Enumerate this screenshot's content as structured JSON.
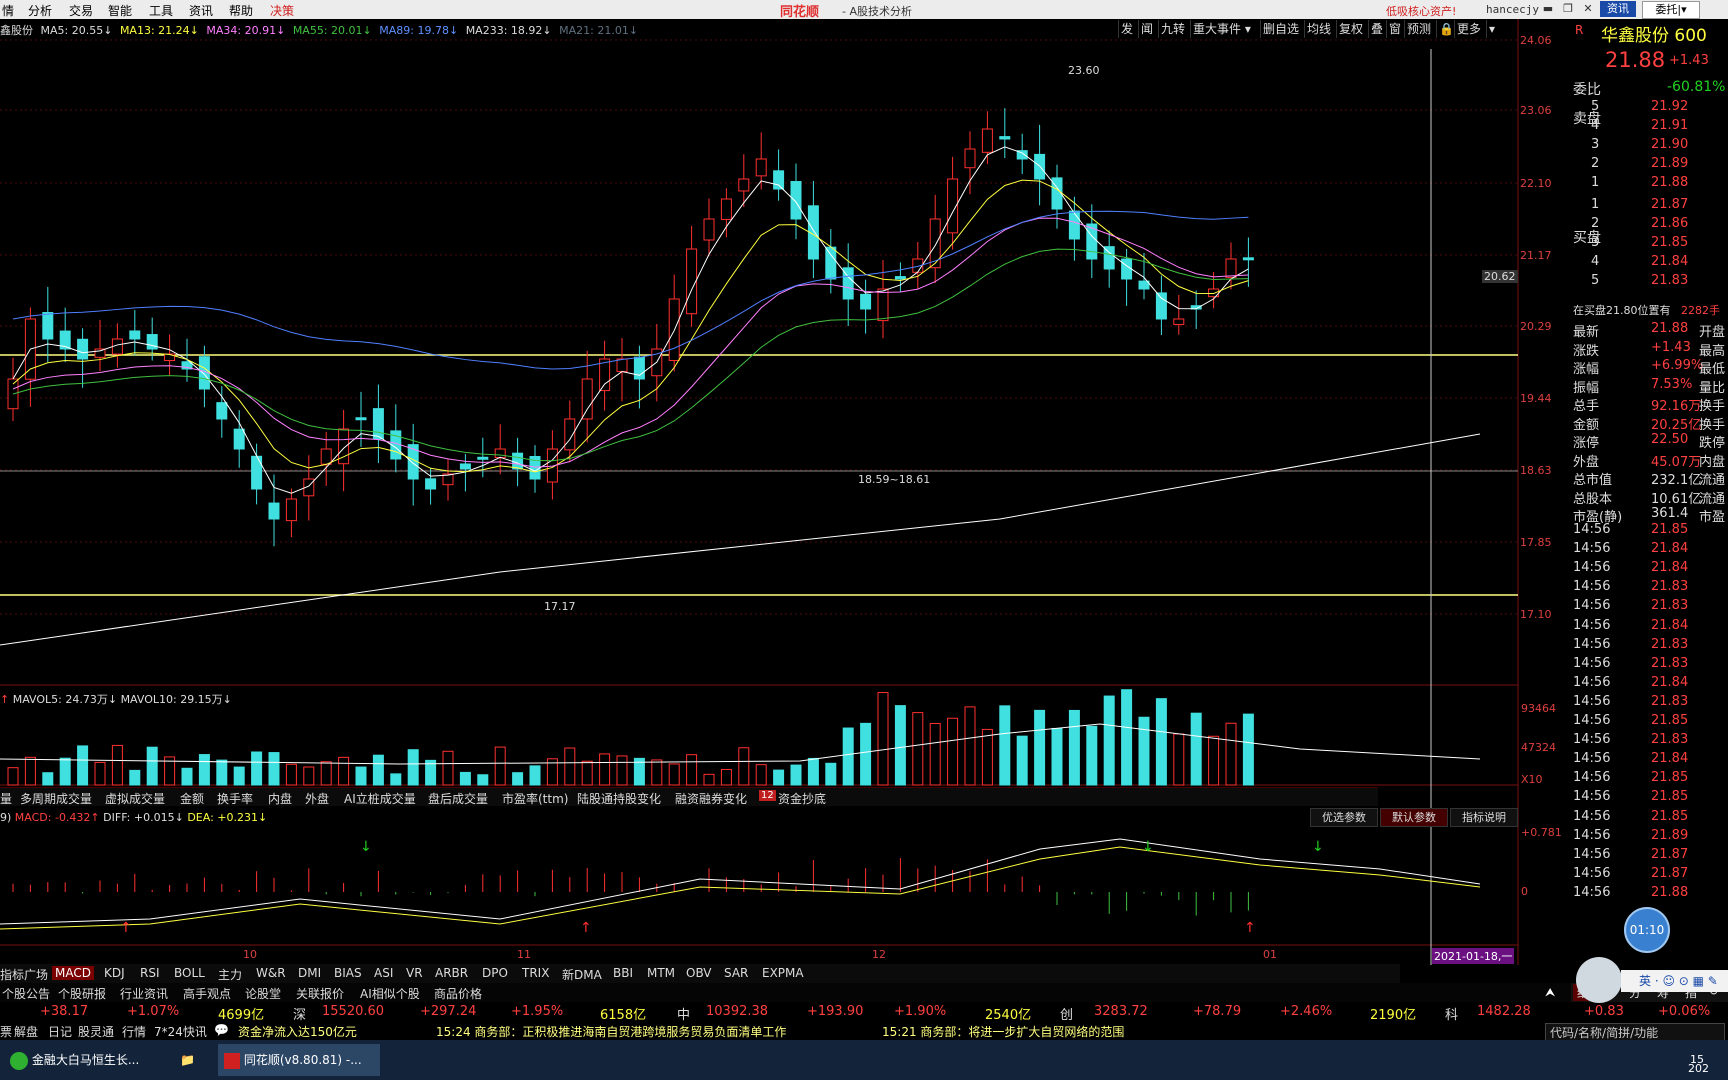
{
  "menubar": {
    "items": [
      "情",
      "分析",
      "交易",
      "智能",
      "工具",
      "资讯",
      "帮助",
      "决策"
    ],
    "brand": "同花顺",
    "subtitle": "- A股技术分析",
    "promo": "低吸核心资产!",
    "user": "hancecjy",
    "tab_news": "资讯",
    "tab_entrust": "委托|▾"
  },
  "ma_legend": {
    "name": "鑫股份",
    "ma5": "MA5: 20.55↓",
    "ma13": "MA13: 21.24↓",
    "ma34": "MA34: 20.91↓",
    "ma55": "MA55: 20.01↓",
    "ma89": "MA89: 19.78↓",
    "ma233": "MA233: 18.92↓",
    "ma21": "MA21: 21.01↓"
  },
  "toolbar": [
    "发",
    "闻",
    "九转",
    "重大事件 ▾",
    "删自选",
    "均线",
    "复权",
    "叠",
    "窗",
    "预测",
    "🔒",
    "更多",
    "▾"
  ],
  "price_axis": [
    "24.06",
    "23.06",
    "22.10",
    "21.17",
    "20.29",
    "19.44",
    "18.63",
    "17.85",
    "17.10"
  ],
  "annotations": {
    "high": "23.60",
    "low": "17.17",
    "range": "18.59~18.61",
    "cur_tag": "20.62"
  },
  "vol_legend": {
    "mavol5": "MAVOL5: 24.73万↓",
    "mavol10": "MAVOL10: 29.15万↓",
    "prefix": "↑"
  },
  "vol_axis": [
    "93464",
    "47324",
    "X10"
  ],
  "vol_tabs": [
    "量",
    "多周期成交量",
    "虚拟成交量",
    "金额",
    "换手率",
    "内盘",
    "外盘",
    "AI立桩成交量",
    "盘后成交量",
    "市盈率(ttm)",
    "陆股通持股变化",
    "融资融券变化",
    "12",
    "资金抄底"
  ],
  "macd_legend": {
    "prefix": "9)",
    "macd": "MACD: -0.432↑",
    "diff": "DIFF: +0.015↓",
    "dea": "DEA: +0.231↓"
  },
  "macd_buttons": [
    "优选参数",
    "默认参数",
    "指标说明"
  ],
  "macd_axis": [
    "+0.781",
    "0"
  ],
  "date_axis": [
    "10",
    "11",
    "12",
    "01"
  ],
  "date_tag": "2021-01-18,一",
  "indicator_tabs": [
    "指标广场",
    "MACD",
    "KDJ",
    "RSI",
    "BOLL",
    "主力",
    "W&R",
    "DMI",
    "BIAS",
    "ASI",
    "VR",
    "ARBR",
    "DPO",
    "TRIX",
    "新DMA",
    "BBI",
    "MTM",
    "OBV",
    "SAR",
    "EXPMA"
  ],
  "info_tabs": [
    "个股公告",
    "个股研报",
    "行业资讯",
    "高手观点",
    "论股堂",
    "关联报价",
    "AI相似个股",
    "商品价格"
  ],
  "index_bar": {
    "sh_chg": "+38.17",
    "sh_pct": "+1.07%",
    "sh_amt": "4699亿",
    "sz_label": "深",
    "sz_val": "15520.60",
    "sz_chg": "+297.24",
    "sz_pct": "+1.95%",
    "sz_amt": "6158亿",
    "zx_label": "中",
    "zx_val": "10392.38",
    "zx_chg": "+193.90",
    "zx_pct": "+1.90%",
    "zx_amt": "2540亿",
    "cy_label": "创",
    "cy_val": "3283.72",
    "cy_chg": "+78.79",
    "cy_pct": "+2.46%",
    "cy_amt": "2190亿",
    "kc_label": "科",
    "kc_val": "1482.28",
    "kc_chg": "+0.83",
    "kc_pct": "+0.06%"
  },
  "ticker": {
    "left": [
      "票",
      "解盘",
      "日记",
      "股灵通",
      "行情",
      "7*24快讯"
    ],
    "news1": "资金净流入达150亿元",
    "news2": "15:24 商务部：正积极推进海南自贸港跨境服务贸易负面清单工作",
    "news3": "15:21 商务部：将进一步扩大自贸网络的范围",
    "search": "代码/名称/简拼/功能"
  },
  "taskbar": {
    "task1": "金融大白马恒生长...",
    "task2": "同花顺(v8.80.81) -...",
    "time": "15",
    "date": "202"
  },
  "right_panel": {
    "title": "华鑫股份 600",
    "tag": "R",
    "price": "21.88",
    "change": "+1.43",
    "weibi_label": "委比",
    "weibi": "-60.81%",
    "sell_label": "卖盘",
    "buy_label": "买盘",
    "sells": [
      {
        "lvl": "5",
        "price": "21.92"
      },
      {
        "lvl": "4",
        "price": "21.91"
      },
      {
        "lvl": "3",
        "price": "21.90"
      },
      {
        "lvl": "2",
        "price": "21.89"
      },
      {
        "lvl": "1",
        "price": "21.88"
      }
    ],
    "buys": [
      {
        "lvl": "1",
        "price": "21.87"
      },
      {
        "lvl": "2",
        "price": "21.86"
      },
      {
        "lvl": "3",
        "price": "21.85"
      },
      {
        "lvl": "4",
        "price": "21.84"
      },
      {
        "lvl": "5",
        "price": "21.83"
      }
    ],
    "zaimai": "在买盘21.80位置有",
    "zaimai_qty": "2282手",
    "stats": [
      {
        "k": "最新",
        "v": "21.88",
        "k2": "开盘"
      },
      {
        "k": "涨跌",
        "v": "+1.43",
        "k2": "最高"
      },
      {
        "k": "涨幅",
        "v": "+6.99%",
        "k2": "最低"
      },
      {
        "k": "振幅",
        "v": "7.53%",
        "k2": "量比"
      },
      {
        "k": "总手",
        "v": "92.16万",
        "k2": "换手"
      },
      {
        "k": "金额",
        "v": "20.25亿",
        "k2": "换手"
      },
      {
        "k": "涨停",
        "v": "22.50",
        "k2": "跌停"
      },
      {
        "k": "外盘",
        "v": "45.07万",
        "k2": "内盘"
      },
      {
        "k": "总市值",
        "v": "232.1亿",
        "k2": "流通"
      },
      {
        "k": "总股本",
        "v": "10.61亿",
        "k2": "流通"
      },
      {
        "k": "市盈(静)",
        "v": "361.4",
        "k2": "市盈"
      }
    ],
    "ticks": [
      {
        "t": "14:56",
        "p": "21.85"
      },
      {
        "t": "14:56",
        "p": "21.84"
      },
      {
        "t": "14:56",
        "p": "21.84"
      },
      {
        "t": "14:56",
        "p": "21.83"
      },
      {
        "t": "14:56",
        "p": "21.83"
      },
      {
        "t": "14:56",
        "p": "21.84"
      },
      {
        "t": "14:56",
        "p": "21.83"
      },
      {
        "t": "14:56",
        "p": "21.83"
      },
      {
        "t": "14:56",
        "p": "21.84"
      },
      {
        "t": "14:56",
        "p": "21.83"
      },
      {
        "t": "14:56",
        "p": "21.85"
      },
      {
        "t": "14:56",
        "p": "21.83"
      },
      {
        "t": "14:56",
        "p": "21.84"
      },
      {
        "t": "14:56",
        "p": "21.85"
      },
      {
        "t": "14:56",
        "p": "21.85"
      },
      {
        "t": "14:56",
        "p": "21.85"
      },
      {
        "t": "14:56",
        "p": "21.89"
      },
      {
        "t": "14:56",
        "p": "21.87"
      },
      {
        "t": "14:56",
        "p": "21.87"
      },
      {
        "t": "14:56",
        "p": "21.88"
      }
    ],
    "tick_highlight": "21.85",
    "bottom_tabs": [
      "细",
      "诊",
      "分",
      "寿",
      "指",
      "↺"
    ],
    "clock": "01:10",
    "ime": "英"
  },
  "colors": {
    "up": "#ff3030",
    "down": "#40e0e0",
    "grid": "#5a1010",
    "ma_white": "#ffffff",
    "ma_yellow": "#ffff40",
    "ma_purple": "#ff80ff",
    "ma_green": "#40c040",
    "ma_blue": "#5080ff"
  }
}
